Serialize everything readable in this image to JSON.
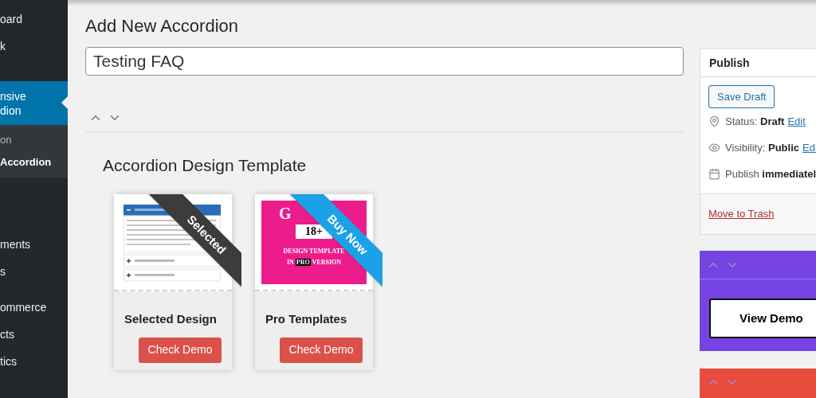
{
  "sidebar": {
    "menu_top": [
      {
        "label": "oard",
        "selected": false
      },
      {
        "label": "k",
        "selected": false
      }
    ],
    "active": {
      "label": "nsive\ndion",
      "selected": true,
      "children": [
        {
          "label": "on",
          "selected": false
        },
        {
          "label": "Accordion",
          "selected": true
        }
      ]
    },
    "menu_middle": [
      {
        "label": "ments",
        "selected": false
      },
      {
        "label": "s",
        "selected": false
      }
    ],
    "menu_lower": [
      {
        "label": "ommerce",
        "selected": false
      },
      {
        "label": "cts",
        "selected": false
      },
      {
        "label": "tics",
        "selected": false
      }
    ]
  },
  "page_title": "Add New Accordion",
  "title_field": {
    "value": "Testing FAQ"
  },
  "design_section": {
    "title": "Accordion Design Template",
    "cards": [
      {
        "kind": "selected",
        "ribbon": "Selected",
        "name": "Selected Design",
        "button": "Check Demo"
      },
      {
        "kind": "pro",
        "ribbon": "Buy Now",
        "name": "Pro Templates",
        "button": "Check Demo",
        "promo": {
          "headline": "G",
          "count": "18+",
          "line1": "DESIGN TEMPLATE",
          "line2_before": "IN",
          "line2_highlight": "PRO",
          "line2_after": "VERSION"
        }
      }
    ]
  },
  "publish": {
    "title": "Publish",
    "save_draft": "Save Draft",
    "rows": [
      {
        "kind": "status",
        "label": "Status:",
        "value": "Draft",
        "link": "Edit"
      },
      {
        "kind": "visibility",
        "label": "Visibility:",
        "value": "Public",
        "link": "Edi"
      },
      {
        "kind": "schedule",
        "label": "Publish",
        "value": "immediatel"
      }
    ],
    "trash": "Move to Trash"
  },
  "demo_box": {
    "color": "#7443e2",
    "button": "View Demo"
  },
  "red_box": {
    "color": "#e74c3c"
  }
}
